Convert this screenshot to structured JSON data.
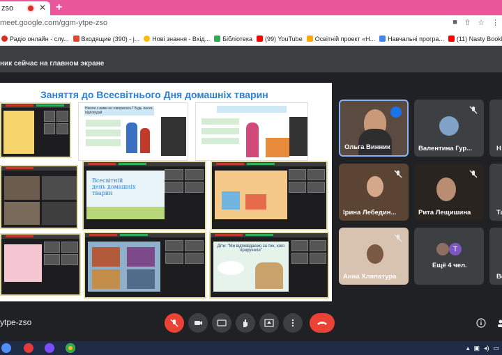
{
  "browser": {
    "tab_title": "zso",
    "tab_close": "✕",
    "new_tab": "+",
    "url": "meet.google.com/ggm-ytpe-zso",
    "bookmarks": [
      {
        "label": "Радіо онлайн - слу..."
      },
      {
        "label": "Входящие (390) - j..."
      },
      {
        "label": "Нові знання - Вхід..."
      },
      {
        "label": "Бібліотека"
      },
      {
        "label": "(99) YouTube"
      },
      {
        "label": "Освітній проект «Н..."
      },
      {
        "label": "Навчальні програ..."
      },
      {
        "label": "(11) Nasty Bookl"
      }
    ]
  },
  "meet": {
    "banner": "ник сейчас на главном экране",
    "slide_title": "Заняття до Всесвітнього Дня домашніх тварин",
    "participants": [
      {
        "name": "Ольга Винник",
        "speaking": true
      },
      {
        "name": "Валентина Гур..."
      },
      {
        "name": "Ірина Лебедин..."
      },
      {
        "name": "Рита Лещишина"
      },
      {
        "name": "Анна Хляпатура"
      },
      {
        "name": "Ещё 4 чел.",
        "avatar_letter": "Т"
      }
    ],
    "cut_names": [
      "Н",
      "Та",
      "Ве"
    ],
    "meeting_code": "ytpe-zso",
    "colors": {
      "accent": "#8ab4f8",
      "danger": "#ea4335",
      "bg": "#202124",
      "tile": "#3c4043"
    }
  },
  "slides": {
    "s2_question": "Ніколи з вами не говорилось? Будь ласка, відповідай",
    "s3_text": "Всесвітній день домашніх тварин",
    "s6_quote": "Діти: \"Ми відповідаємо за тих, кого приручили\""
  }
}
